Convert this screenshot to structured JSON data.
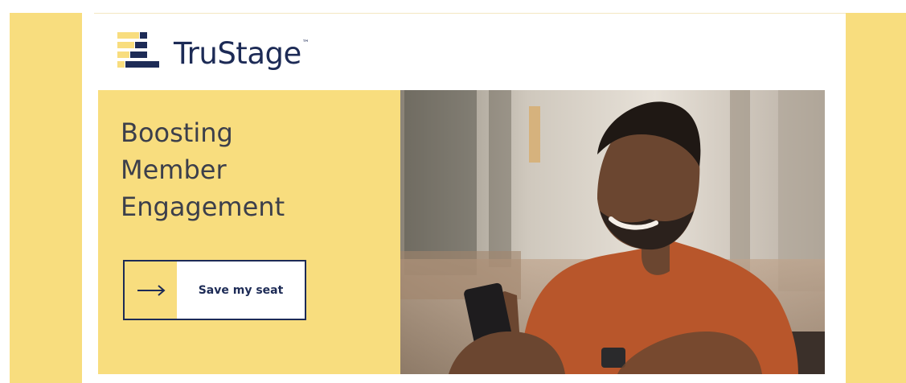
{
  "brand": {
    "name": "TruStage",
    "trademark": "™"
  },
  "hero": {
    "title_lines": [
      "Boosting",
      "Member",
      "Engagement"
    ],
    "cta_label": "Save my seat",
    "cta_icon": "arrow-right-icon",
    "photo": "man-smiling-at-phone"
  },
  "colors": {
    "brand_yellow": "#f8dd7e",
    "brand_navy": "#1d2b56",
    "headline_text": "#3c3f4b"
  }
}
